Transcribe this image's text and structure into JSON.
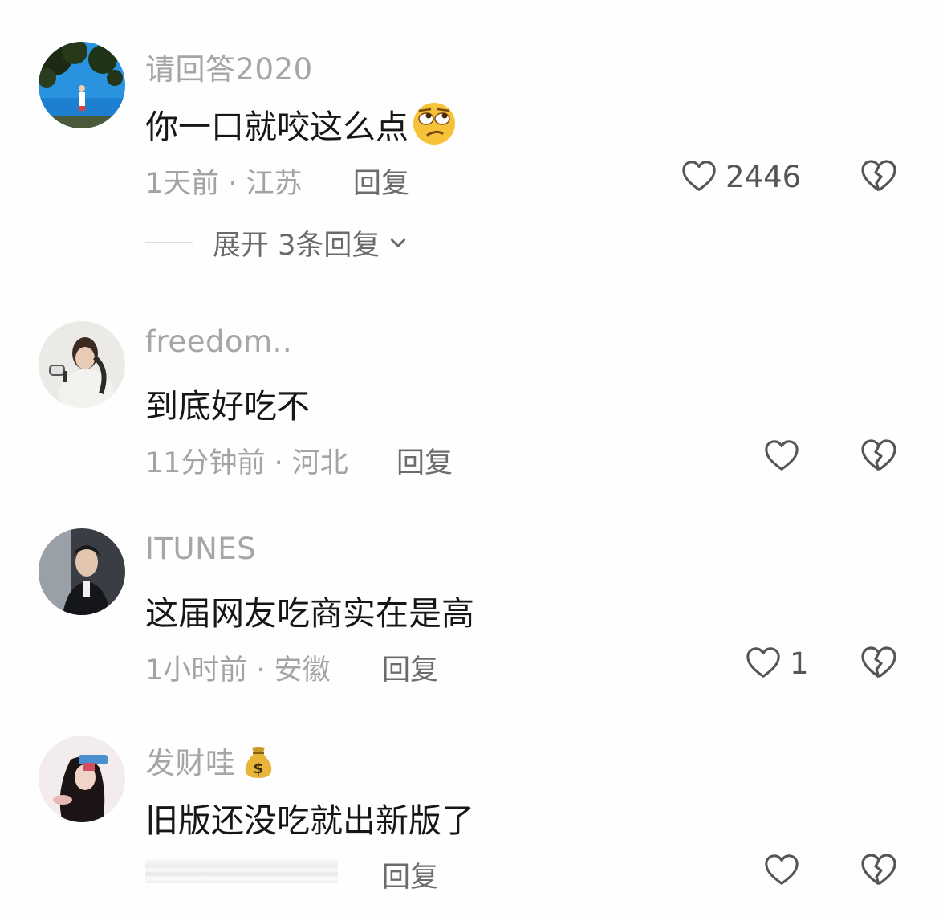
{
  "comments": [
    {
      "username": "请回答2020",
      "text": "你一口就咬这么点",
      "emoji": "rolling-eyes-emoji",
      "meta": "1天前 · 江苏",
      "reply_label": "回复",
      "likes": "2446",
      "expand_label": "展开 3条回复"
    },
    {
      "username": "freedom..",
      "text": "到底好吃不",
      "meta": "11分钟前 · 河北",
      "reply_label": "回复",
      "likes": ""
    },
    {
      "username": "ITUNES",
      "text": "这届网友吃商实在是高",
      "meta": "1小时前 · 安徽",
      "reply_label": "回复",
      "likes": "1"
    },
    {
      "username": "发财哇",
      "username_emoji": "money-bag-emoji",
      "text": "旧版还没吃就出新版了",
      "meta": "",
      "reply_label": "回复",
      "likes": ""
    }
  ],
  "colors": {
    "username": "#a6a6a6",
    "comment_text": "#161616",
    "meta": "#a3a3a3",
    "icon": "#555555"
  }
}
